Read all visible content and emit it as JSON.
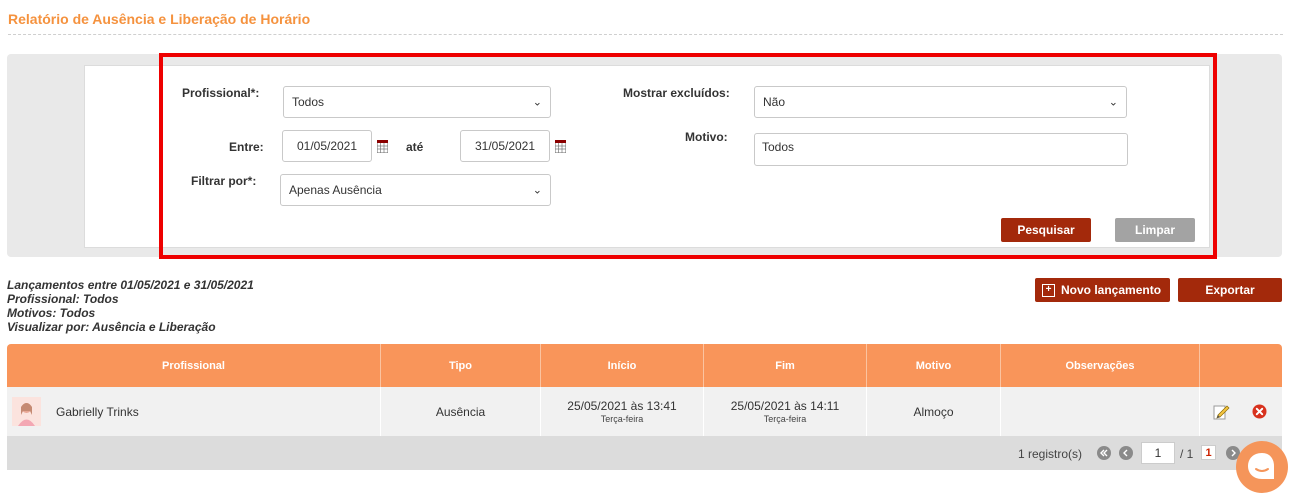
{
  "page": {
    "title": "Relatório de Ausência e Liberação de Horário"
  },
  "filters": {
    "profissional_label": "Profissional*:",
    "profissional_value": "Todos",
    "entre_label": "Entre:",
    "date_from": "01/05/2021",
    "ate_label": "até",
    "date_to": "31/05/2021",
    "filtrar_label": "Filtrar por*:",
    "filtrar_value": "Apenas Ausência",
    "mostrar_label": "Mostrar excluídos:",
    "mostrar_value": "Não",
    "motivo_label": "Motivo:",
    "motivo_value": "Todos",
    "search_button": "Pesquisar",
    "clear_button": "Limpar"
  },
  "summary": {
    "line1": "Lançamentos entre 01/05/2021 e 31/05/2021",
    "line2": "Profissional: Todos",
    "line3": "Motivos: Todos",
    "line4": "Visualizar por: Ausência e Liberação"
  },
  "actions": {
    "new_button": "Novo lançamento",
    "export_button": "Exportar"
  },
  "table": {
    "columns": [
      "Profissional",
      "Tipo",
      "Início",
      "Fim",
      "Motivo",
      "Observações"
    ],
    "rows": [
      {
        "profissional": "Gabrielly Trinks",
        "tipo": "Ausência",
        "inicio": "25/05/2021 às 13:41",
        "inicio_dia": "Terça-feira",
        "fim": "25/05/2021 às 14:11",
        "fim_dia": "Terça-feira",
        "motivo": "Almoço",
        "observacoes": ""
      }
    ]
  },
  "pagination": {
    "records": "1 registro(s)",
    "page_input": "1",
    "total": "/ 1",
    "current": "1"
  },
  "colors": {
    "accent": "#f5923e",
    "header": "#f9955a",
    "button_dark": "#a3290b",
    "highlight": "#ee0000"
  },
  "icons": [
    "calendar-icon",
    "plus-icon",
    "edit-icon",
    "delete-icon",
    "chat-icon",
    "chevron-down-icon"
  ]
}
